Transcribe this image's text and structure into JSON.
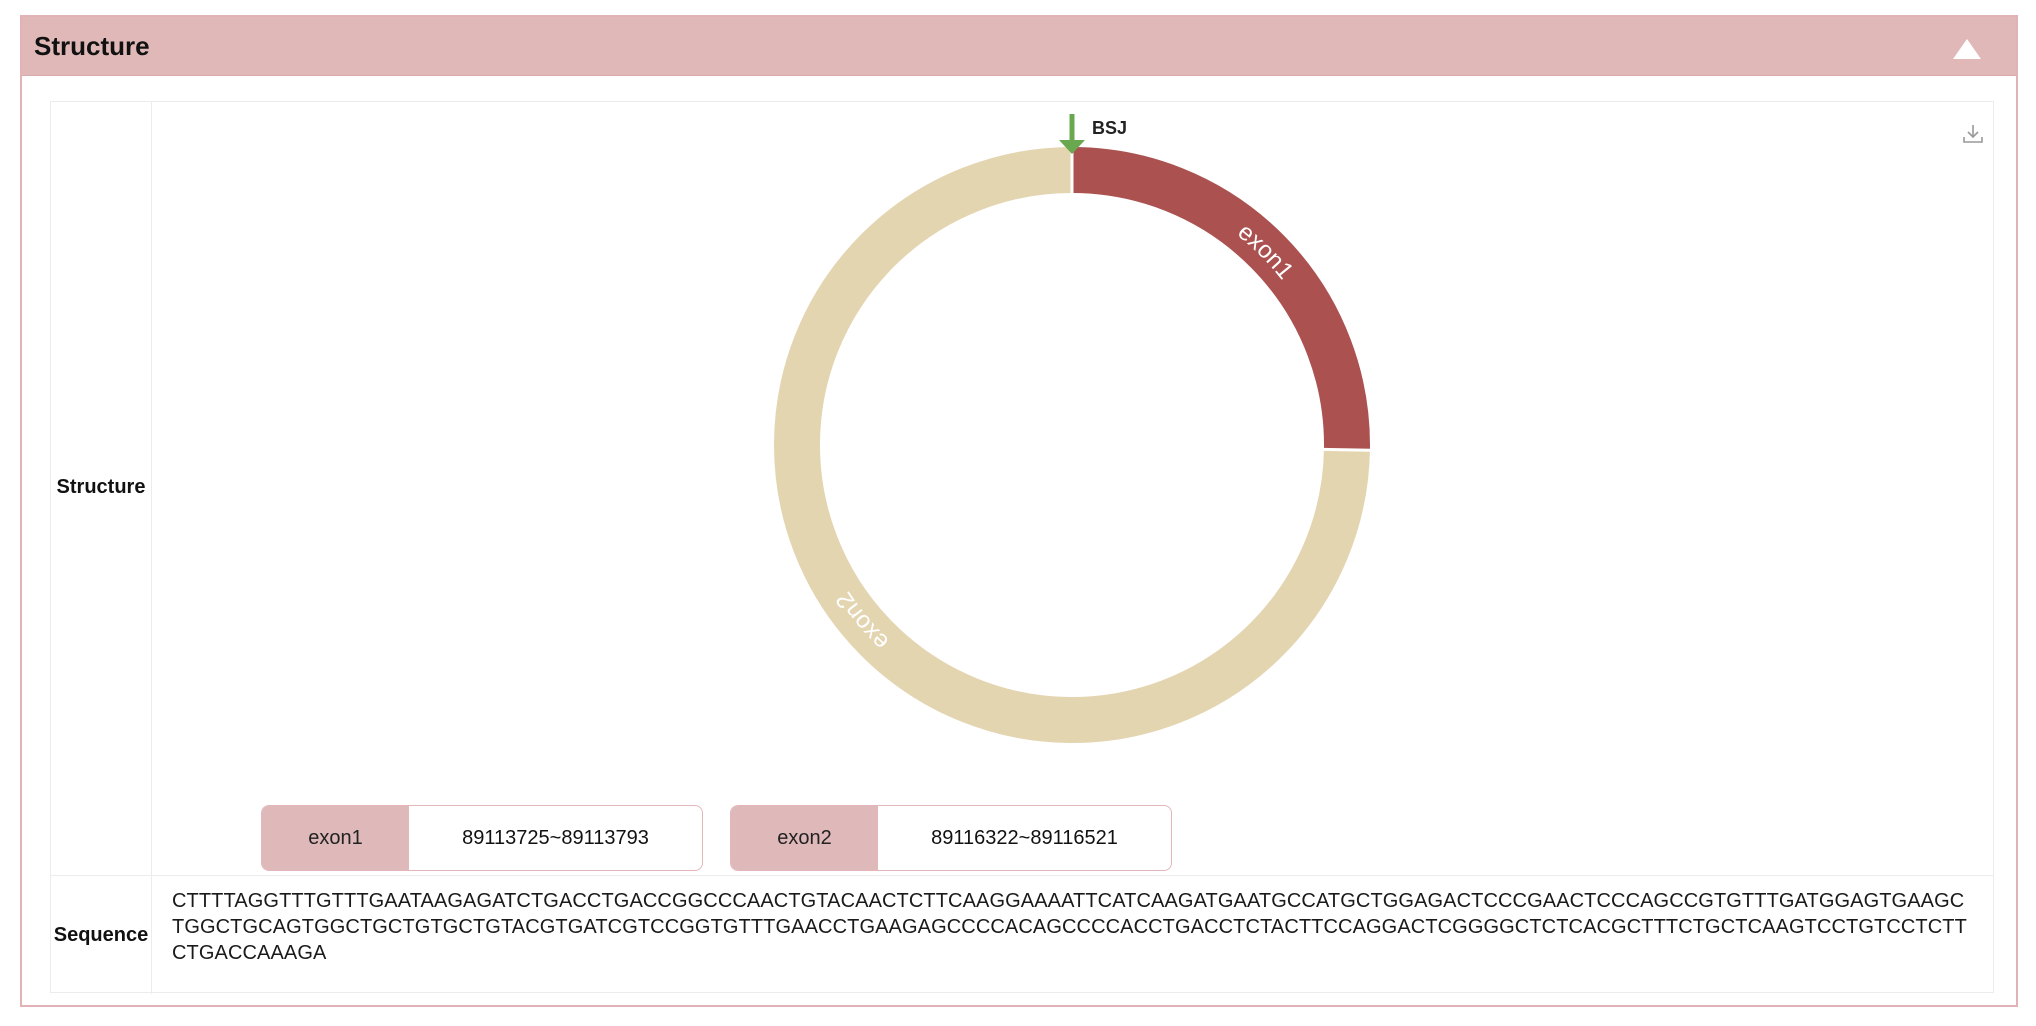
{
  "panel": {
    "title": "Structure",
    "collapse_icon": "triangle-up-icon"
  },
  "structure_row": {
    "label": "Structure",
    "download_icon": "download-icon",
    "bsj_label": "BSJ",
    "colors": {
      "exon1": "#ab5250",
      "exon2": "#e4d5b1",
      "bsj_arrow": "#6aa84f",
      "header_bg": "#e0b8b8",
      "border": "#e2b3b6"
    },
    "exons": [
      {
        "name": "exon1",
        "range": "89113725~89113793"
      },
      {
        "name": "exon2",
        "range": "89116322~89116521"
      }
    ]
  },
  "sequence_row": {
    "label": "Sequence",
    "sequence": "CTTTTAGGTTTGTTTGAATAAGAGATCTGACCTGACCGGCCCAACTGTACAACTCTTCAAGGAAAATTCATCAAGATGAATGCCATGCTGGAGACTCCCGAACTCCCAGCCGTGTTTGATGGAGTGAAGCTGGCTGCAGTGGCTGCTGTGCTGTACGTGATCGTCCGGTGTTTGAACCTGAAGAGCCCCACAGCCCCACCTGACCTCTACTTCCAGGACTCGGGGCTCTCACGCTTTCTGCTCAAGTCCTGTCCTCTTCTGACCAAAGA"
  }
}
